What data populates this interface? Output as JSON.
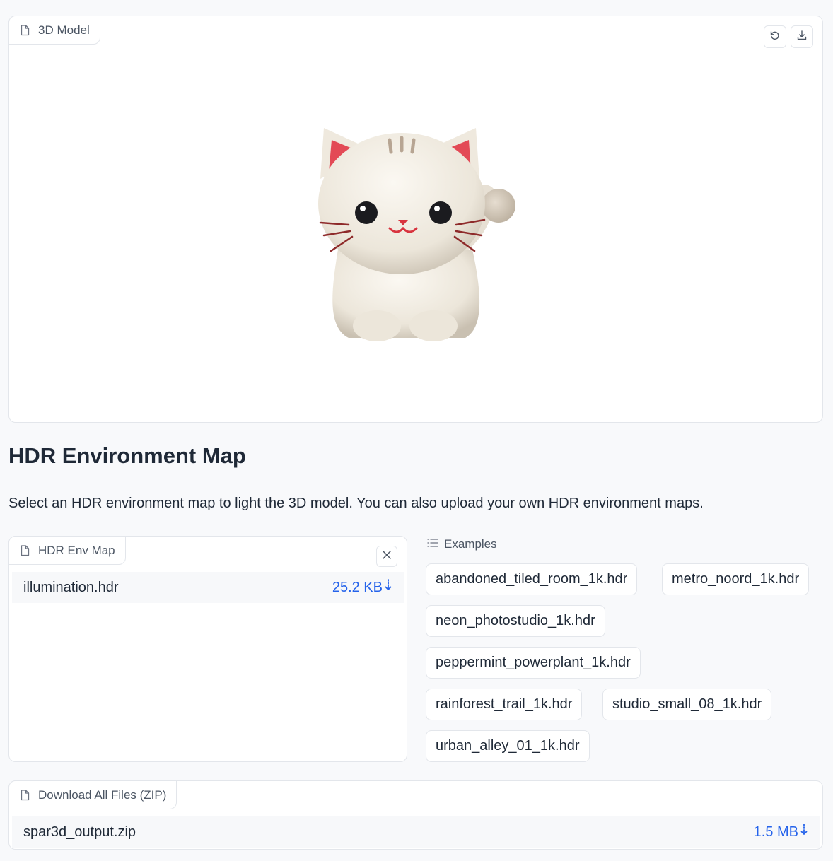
{
  "model_panel": {
    "label": "3D Model",
    "icons": [
      "file-icon",
      "reset-icon",
      "download-icon"
    ]
  },
  "hdr_section": {
    "title": "HDR Environment Map",
    "description": "Select an HDR environment map to light the 3D model. You can also upload your own HDR environment maps."
  },
  "hdr_panel": {
    "label": "HDR Env Map",
    "file": {
      "name": "illumination.hdr",
      "size": "25.2 KB"
    }
  },
  "examples": {
    "label": "Examples",
    "items": [
      "abandoned_tiled_room_1k.hdr",
      "metro_noord_1k.hdr",
      "neon_photostudio_1k.hdr",
      "peppermint_powerplant_1k.hdr",
      "rainforest_trail_1k.hdr",
      "studio_small_08_1k.hdr",
      "urban_alley_01_1k.hdr"
    ]
  },
  "zip_panel": {
    "label": "Download All Files (ZIP)",
    "file": {
      "name": "spar3d_output.zip",
      "size": "1.5 MB"
    }
  },
  "colors": {
    "link": "#2563eb",
    "border": "#e3e6eb",
    "background": "#f8f9fb",
    "text": "#1f2937"
  }
}
